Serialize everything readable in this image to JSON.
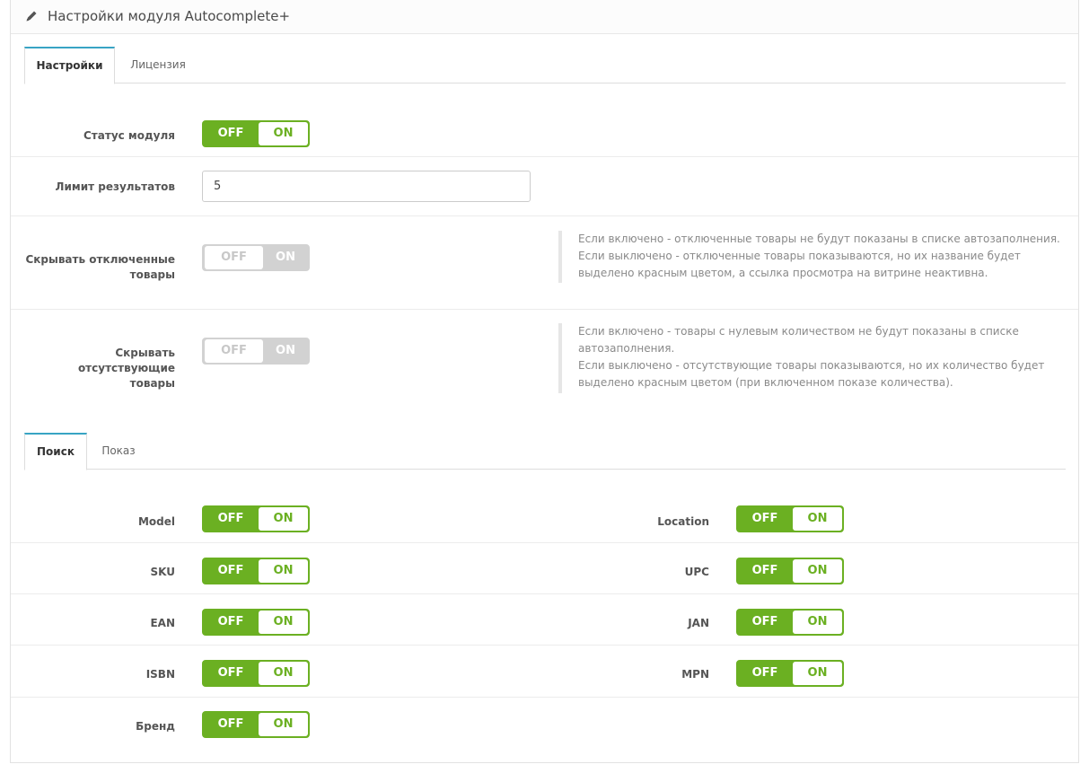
{
  "heading": {
    "title": "Настройки модуля Autocomplete+",
    "icon": "pencil-icon"
  },
  "top_tabs": [
    {
      "label": "Настройки",
      "active": true
    },
    {
      "label": "Лицензия",
      "active": false
    }
  ],
  "settings": {
    "status": {
      "label": "Статус модуля",
      "off": "OFF",
      "on": "ON",
      "value": "ON"
    },
    "limit": {
      "label": "Лимит результатов",
      "value": "5"
    },
    "hide_disabled": {
      "label_line1": "Скрывать отключенные",
      "label_line2": "товары",
      "off": "OFF",
      "on": "ON",
      "value": "OFF",
      "help": [
        "Если включено - отключенные товары не будут показаны в списке автозаполнения.",
        "Если выключено - отключенные товары показываются, но их название будет",
        "выделено красным цветом, а ссылка просмотра на витрине неактивна."
      ]
    },
    "hide_missing": {
      "label_line1": "Скрывать отсутствующие",
      "label_line2": "товары",
      "off": "OFF",
      "on": "ON",
      "value": "OFF",
      "help": [
        "Если включено - товары с нулевым количеством не будут показаны в списке",
        "автозаполнения.",
        "Если выключено - отсутствующие товары показываются, но их количество будет",
        "выделено красным цветом (при включенном показе количества)."
      ]
    }
  },
  "sub_tabs": [
    {
      "label": "Поиск",
      "active": true
    },
    {
      "label": "Показ",
      "active": false
    }
  ],
  "search_fields": {
    "left": [
      {
        "label": "Model",
        "off": "OFF",
        "on": "ON",
        "value": "ON"
      },
      {
        "label": "SKU",
        "off": "OFF",
        "on": "ON",
        "value": "ON"
      },
      {
        "label": "EAN",
        "off": "OFF",
        "on": "ON",
        "value": "ON"
      },
      {
        "label": "ISBN",
        "off": "OFF",
        "on": "ON",
        "value": "ON"
      },
      {
        "label": "Бренд",
        "off": "OFF",
        "on": "ON",
        "value": "ON"
      }
    ],
    "right": [
      {
        "label": "Location",
        "off": "OFF",
        "on": "ON",
        "value": "ON"
      },
      {
        "label": "UPC",
        "off": "OFF",
        "on": "ON",
        "value": "ON"
      },
      {
        "label": "JAN",
        "off": "OFF",
        "on": "ON",
        "value": "ON"
      },
      {
        "label": "MPN",
        "off": "OFF",
        "on": "ON",
        "value": "ON"
      }
    ]
  },
  "colors": {
    "toggle_on": "#6bb022",
    "toggle_disabled": "#d2d2d2",
    "tab_accent": "#38a4c4"
  }
}
